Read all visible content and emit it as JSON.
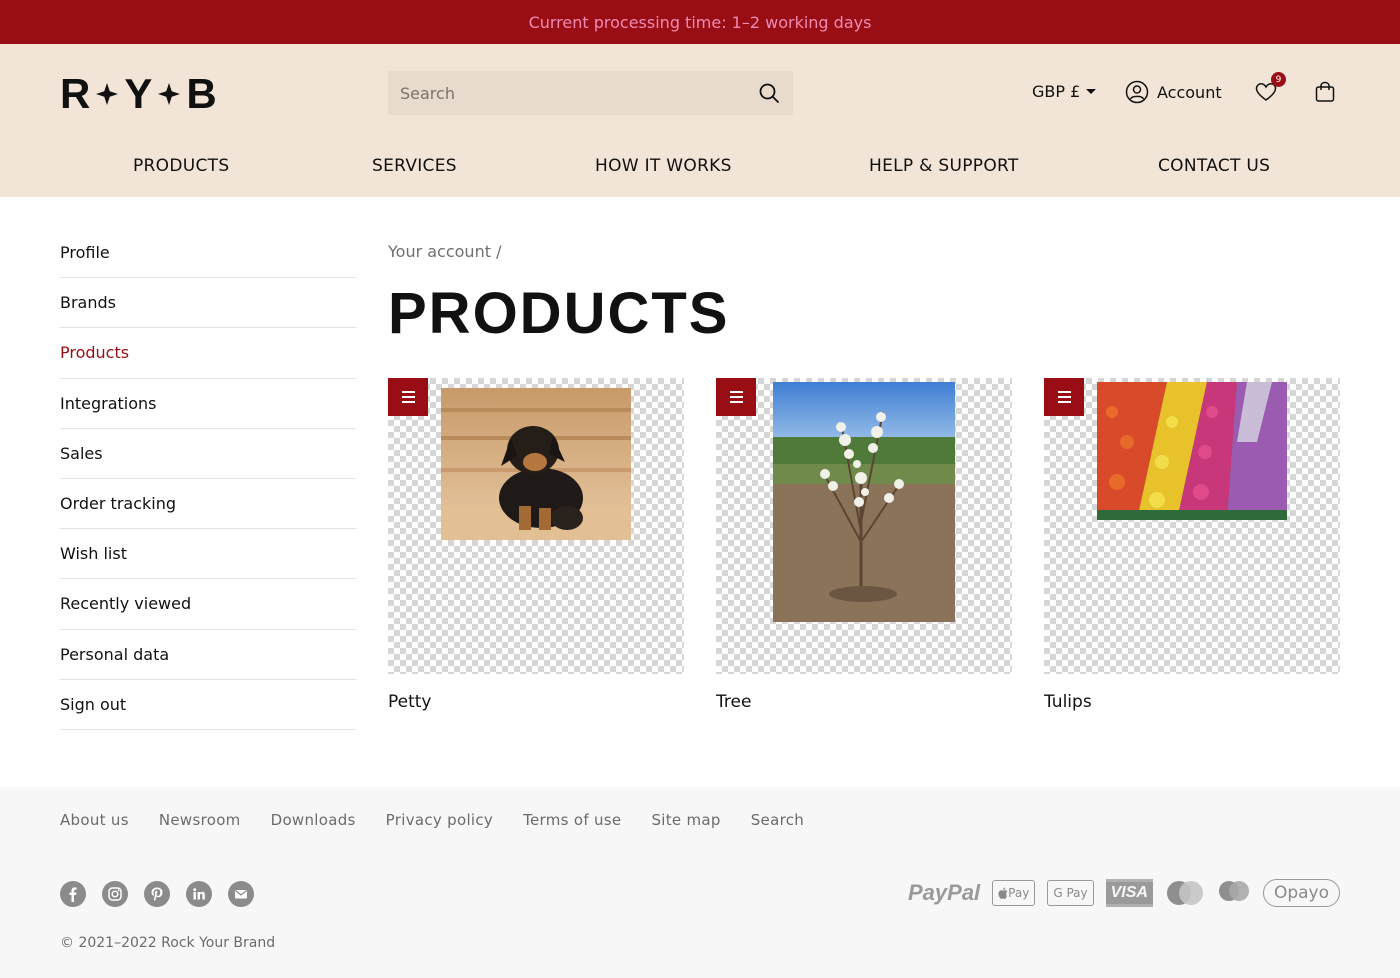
{
  "topbar": {
    "text": "Current processing time: 1–2 working days"
  },
  "header": {
    "logo": [
      "R",
      "Y",
      "B"
    ],
    "search_placeholder": "Search",
    "currency": "GBP £",
    "account_label": "Account",
    "wishlist_count": "9"
  },
  "nav": [
    {
      "label": "PRODUCTS"
    },
    {
      "label": "SERVICES"
    },
    {
      "label": "HOW IT WORKS"
    },
    {
      "label": "HELP & SUPPORT"
    },
    {
      "label": "CONTACT US"
    }
  ],
  "sidebar": {
    "active": "Products",
    "items": [
      {
        "label": "Profile"
      },
      {
        "label": "Brands"
      },
      {
        "label": "Products"
      },
      {
        "label": "Integrations"
      },
      {
        "label": "Sales"
      },
      {
        "label": "Order tracking"
      },
      {
        "label": "Wish list"
      },
      {
        "label": "Recently viewed"
      },
      {
        "label": "Personal data"
      },
      {
        "label": "Sign out"
      }
    ]
  },
  "breadcrumb": "Your account  /",
  "page_title": "PRODUCTS",
  "products": [
    {
      "name": "Petty"
    },
    {
      "name": "Tree"
    },
    {
      "name": "Tulips"
    }
  ],
  "footer": {
    "links": [
      {
        "label": "About us"
      },
      {
        "label": "Newsroom"
      },
      {
        "label": "Downloads"
      },
      {
        "label": "Privacy policy"
      },
      {
        "label": "Terms of use"
      },
      {
        "label": "Site map"
      },
      {
        "label": "Search"
      }
    ],
    "payments": {
      "paypal": "PayPal",
      "applepay": "Pay",
      "googlepay": "G Pay",
      "visa": "VISA",
      "opayo": "Opayo"
    },
    "copyright": "© 2021–2022 Rock Your Brand"
  },
  "colors": {
    "brand": "#990e15",
    "header_bg": "#f2e5d8",
    "topbar_text": "#f08ab0"
  }
}
